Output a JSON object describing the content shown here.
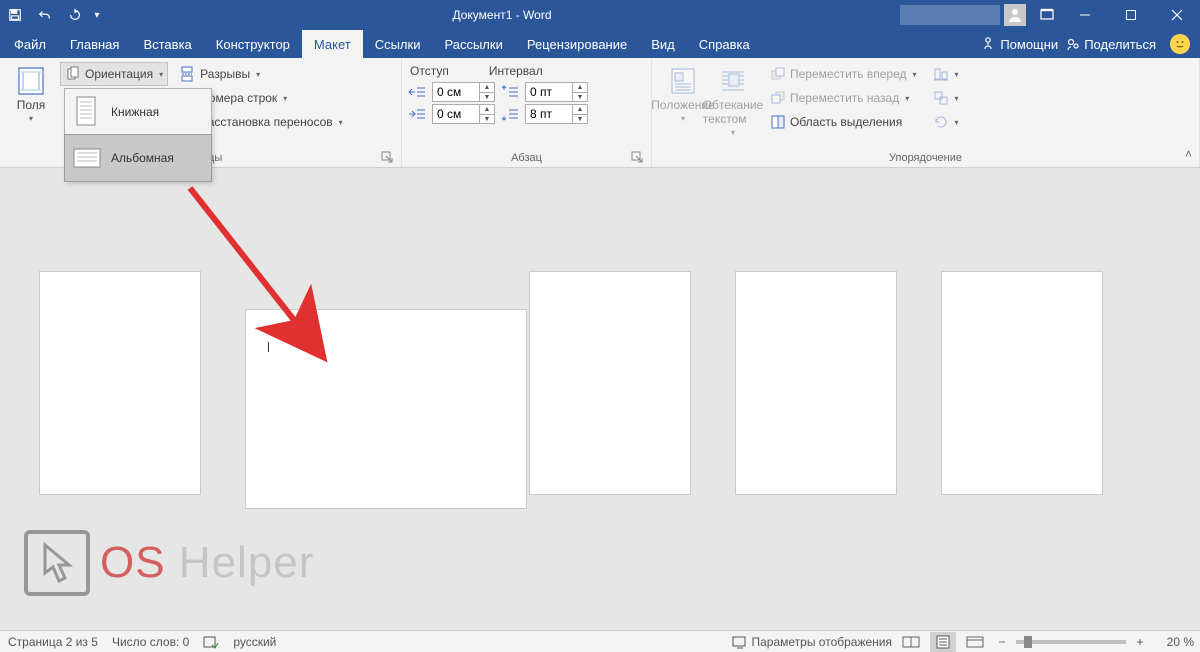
{
  "title": {
    "caption": "Документ1  -  Word"
  },
  "tabs": {
    "file": "Файл",
    "home": "Главная",
    "insert": "Вставка",
    "design": "Конструктор",
    "layout": "Макет",
    "references": "Ссылки",
    "mailings": "Рассылки",
    "review": "Рецензирование",
    "view": "Вид",
    "help": "Справка",
    "tell_me": "Помощни",
    "share": "Поделиться"
  },
  "ribbon": {
    "margins": "Поля",
    "orientation": "Ориентация",
    "orient_portrait": "Книжная",
    "orient_landscape": "Альбомная",
    "breaks": "Разрывы",
    "line_numbers": "Номера строк",
    "hyphenation": "Расстановка переносов",
    "group_page": "траницы",
    "para_indent": "Отступ",
    "para_spacing": "Интервал",
    "indent_left": "0 см",
    "indent_right": "0 см",
    "space_before": "0 пт",
    "space_after": "8 пт",
    "group_para": "Абзац",
    "position": "Положение",
    "wrap": "Обтекание текстом",
    "bring_forward": "Переместить вперед",
    "send_backward": "Переместить назад",
    "selection_pane": "Область выделения",
    "group_arrange": "Упорядочение"
  },
  "status": {
    "page": "Страница 2 из 5",
    "words": "Число слов: 0",
    "lang": "русский",
    "display_settings": "Параметры отображения",
    "zoom": "20 %"
  },
  "watermark": {
    "os": "OS",
    "helper": " Helper"
  }
}
